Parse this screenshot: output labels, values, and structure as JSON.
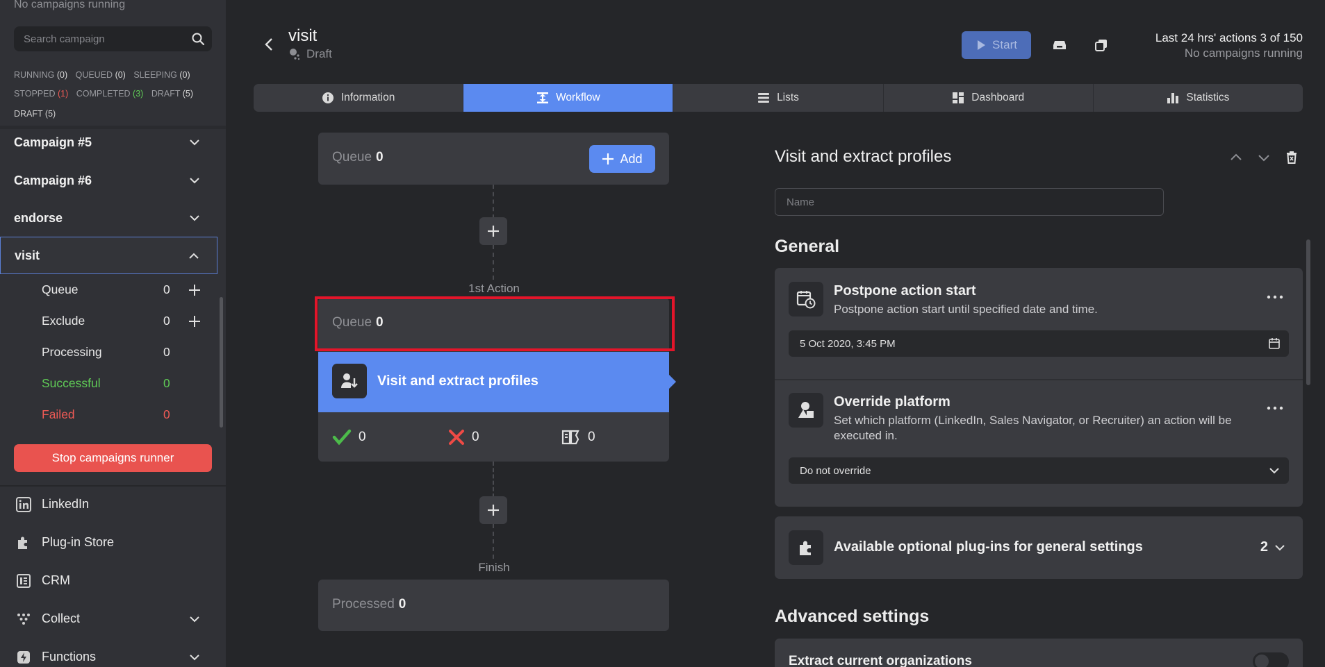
{
  "sidebar": {
    "top_status": "No campaigns running",
    "search_placeholder": "Search campaign",
    "filters": {
      "running_label": "Running",
      "running_count": "(0)",
      "queued_label": "Queued",
      "queued_count": "(0)",
      "sleeping_label": "Sleeping",
      "sleeping_count": "(0)",
      "stopped_label": "Stopped",
      "stopped_count": "(1)",
      "completed_label": "Completed",
      "completed_count": "(3)",
      "draft_label": "Draft",
      "draft_count": "(5)"
    },
    "draft_heading": "DRAFT (5)",
    "campaigns": [
      {
        "label": "Campaign #5"
      },
      {
        "label": "Campaign #6"
      },
      {
        "label": "endorse"
      },
      {
        "label": "visit"
      }
    ],
    "visit_items": [
      {
        "label": "Queue",
        "value": "0"
      },
      {
        "label": "Exclude",
        "value": "0"
      },
      {
        "label": "Processing",
        "value": "0"
      },
      {
        "label": "Successful",
        "value": "0"
      },
      {
        "label": "Failed",
        "value": "0"
      }
    ],
    "stop_button": "Stop campaigns runner",
    "nav": [
      {
        "label": "LinkedIn",
        "icon": "linkedin-icon"
      },
      {
        "label": "Plug-in Store",
        "icon": "puzzle-icon"
      },
      {
        "label": "CRM",
        "icon": "crm-icon"
      },
      {
        "label": "Collect",
        "icon": "collect-icon"
      },
      {
        "label": "Functions",
        "icon": "functions-icon"
      }
    ]
  },
  "header": {
    "title": "visit",
    "status": "Draft",
    "start_label": "Start",
    "stats_line1": "Last 24 hrs' actions 3 of 150",
    "stats_line2": "No campaigns running"
  },
  "tabs": [
    {
      "label": "Information",
      "icon": "info-icon"
    },
    {
      "label": "Workflow",
      "icon": "workflow-icon"
    },
    {
      "label": "Lists",
      "icon": "list-icon"
    },
    {
      "label": "Dashboard",
      "icon": "dashboard-icon"
    },
    {
      "label": "Statistics",
      "icon": "bar-chart-icon"
    }
  ],
  "workflow": {
    "queue_label": "Queue",
    "queue_value": "0",
    "add_label": "Add",
    "action_label": "1st Action",
    "action_queue_label": "Queue",
    "action_queue_value": "0",
    "action_title": "Visit and extract profiles",
    "success_count": "0",
    "failed_count": "0",
    "skipped_count": "0",
    "finish_label": "Finish",
    "processed_label": "Processed",
    "processed_value": "0"
  },
  "panel": {
    "title": "Visit and extract profiles",
    "name_placeholder": "Name",
    "general_heading": "General",
    "postpone_title": "Postpone action start",
    "postpone_desc": "Postpone action start until specified date and time.",
    "postpone_value": "5 Oct 2020, 3:45 PM",
    "override_title": "Override platform",
    "override_desc": "Set which platform (LinkedIn, Sales Navigator, or Recruiter) an action will be executed in.",
    "override_value": "Do not override",
    "plugins_title": "Available optional plug-ins for general settings",
    "plugins_count": "2",
    "advanced_heading": "Advanced settings",
    "extract_label": "Extract current organizations"
  },
  "colors": {
    "accent": "#5b8af0",
    "danger": "#e9534f",
    "success": "#5fcb56",
    "highlight": "#e3152a"
  }
}
